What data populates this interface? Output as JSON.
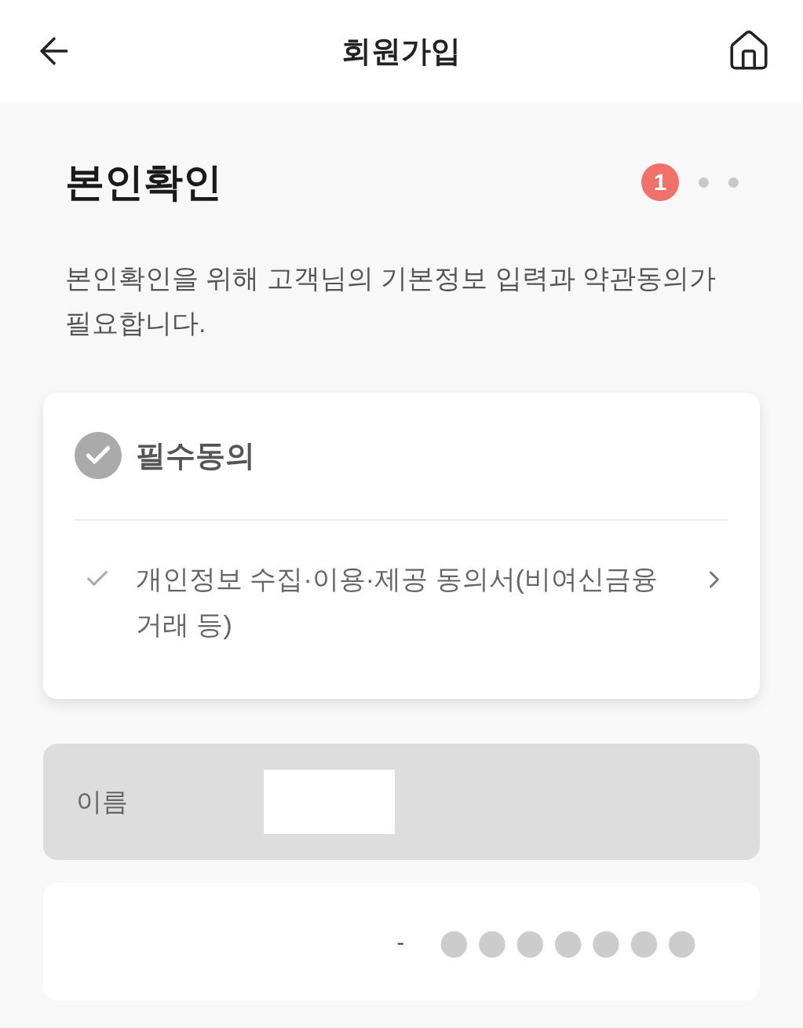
{
  "header": {
    "title": "회원가입"
  },
  "heading": "본인확인",
  "steps": [
    {
      "label": "1",
      "selected": true
    },
    {
      "selected": false
    },
    {
      "selected": false
    }
  ],
  "description": "본인확인을 위해 고객님의 기본정보 입력과 약관동의가 필요합니다.",
  "agreement": {
    "title": "필수동의",
    "checked": false,
    "items": [
      {
        "label": "개인정보 수집·이용·제공 동의서(비여신금융 거래 등)",
        "checked": false
      }
    ]
  },
  "fields": [
    {
      "kind": "name",
      "label": "이름",
      "disabled": true,
      "redacted": true
    },
    {
      "kind": "masked",
      "disabled": false,
      "separator": "-",
      "masked_value": "●●●●●●●"
    }
  ]
}
